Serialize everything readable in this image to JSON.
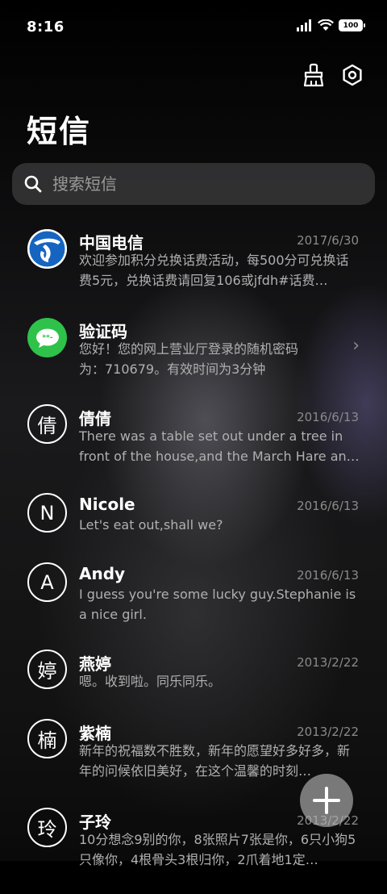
{
  "status_bar": {
    "time": "8:16",
    "battery": "100"
  },
  "header": {
    "title": "短信"
  },
  "search": {
    "placeholder": "搜索短信"
  },
  "messages": [
    {
      "name": "中国电信",
      "date": "2017/6/30",
      "preview": "欢迎参加积分兑换话费活动，每500分可兑换话费5元，兑换话费请回复106或jfdh#话费…",
      "avatar": "telecom-logo"
    },
    {
      "name": "验证码",
      "date": "",
      "preview": "您好！您的网上营业厅登录的随机密码为：710679。有效时间为3分钟",
      "avatar": "message-icon"
    },
    {
      "name": "倩倩",
      "date": "2016/6/13",
      "preview": "There was a table set out under a tree in front of the house,and the March Hare an…",
      "avatar_letter": "倩"
    },
    {
      "name": "Nicole",
      "date": "2016/6/13",
      "preview": "Let's eat out,shall we?",
      "avatar_letter": "N"
    },
    {
      "name": "Andy",
      "date": "2016/6/13",
      "preview": "I guess you're some lucky guy.Stephanie is a nice girl.",
      "avatar_letter": "A"
    },
    {
      "name": "燕婷",
      "date": "2013/2/22",
      "preview": "嗯。收到啦。同乐同乐。",
      "avatar_letter": "婷"
    },
    {
      "name": "紫楠",
      "date": "2013/2/22",
      "preview": "新年的祝福数不胜数，新年的愿望好多好多，新年的问候依旧美好，在这个温馨的时刻…",
      "avatar_letter": "楠"
    },
    {
      "name": "子玲",
      "date": "2013/2/22",
      "preview": "10分想念9别的你，8张照片7张是你，6只小狗5只像你，4根骨头3根归你，2爪着地1定…",
      "avatar_letter": "玲"
    }
  ]
}
